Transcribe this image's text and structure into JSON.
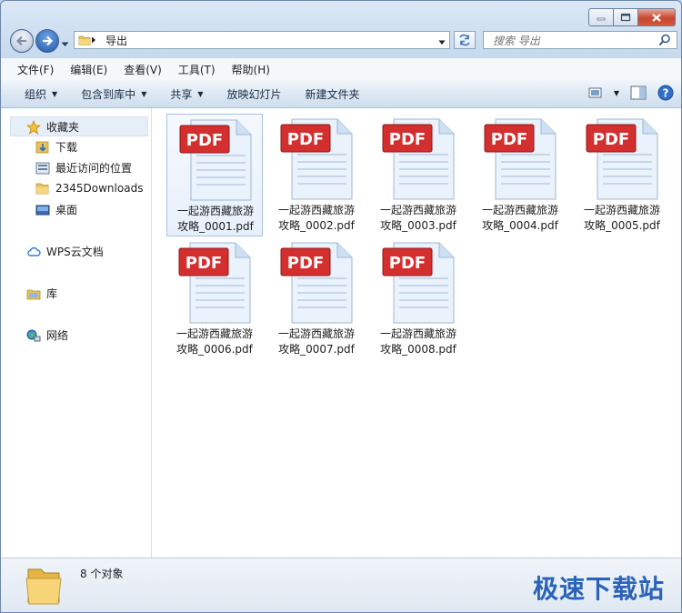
{
  "window": {
    "address": {
      "location": "导出"
    },
    "search": {
      "placeholder": "搜索 导出"
    }
  },
  "menubar": {
    "items": [
      {
        "label": "文件(F)"
      },
      {
        "label": "编辑(E)"
      },
      {
        "label": "查看(V)"
      },
      {
        "label": "工具(T)"
      },
      {
        "label": "帮助(H)"
      }
    ]
  },
  "toolbar": {
    "organize": "组织",
    "include_library": "包含到库中",
    "share": "共享",
    "slideshow": "放映幻灯片",
    "new_folder": "新建文件夹"
  },
  "sidebar": {
    "favorites": "收藏夹",
    "fav_items": [
      "下载",
      "最近访问的位置",
      "2345Downloads",
      "桌面"
    ],
    "wps": "WPS云文档",
    "libraries": "库",
    "network": "网络"
  },
  "files": [
    {
      "name": "一起游西藏旅游\n攻略_0001.pdf",
      "icon_label": "PDF"
    },
    {
      "name": "一起游西藏旅游\n攻略_0002.pdf",
      "icon_label": "PDF"
    },
    {
      "name": "一起游西藏旅游\n攻略_0003.pdf",
      "icon_label": "PDF"
    },
    {
      "name": "一起游西藏旅游\n攻略_0004.pdf",
      "icon_label": "PDF"
    },
    {
      "name": "一起游西藏旅游\n攻略_0005.pdf",
      "icon_label": "PDF"
    },
    {
      "name": "一起游西藏旅游\n攻略_0006.pdf",
      "icon_label": "PDF"
    },
    {
      "name": "一起游西藏旅游\n攻略_0007.pdf",
      "icon_label": "PDF"
    },
    {
      "name": "一起游西藏旅游\n攻略_0008.pdf",
      "icon_label": "PDF"
    }
  ],
  "status": {
    "count": "8 个对象"
  },
  "watermark": "极速下载站",
  "colors": {
    "pdf_red": "#d32f2f",
    "accent": "#2a63b8"
  }
}
